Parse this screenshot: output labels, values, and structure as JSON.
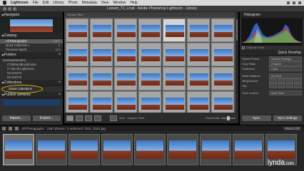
{
  "menubar": {
    "items": [
      "Lightroom",
      "File",
      "Edit",
      "Library",
      "Photo",
      "Metadata",
      "View",
      "Window",
      "Help"
    ]
  },
  "window": {
    "title": "Lesson_T1_Lrcat - Adobe Photoshop Lightroom - Library"
  },
  "left_panel": {
    "navigator_title": "Navigator",
    "catalog_title": "Catalog",
    "catalog_items": [
      {
        "label": "All Photographs",
        "count": "1267"
      },
      {
        "label": "Quick Collection +",
        "count": "0"
      },
      {
        "label": "Previous Import",
        "count": "113"
      }
    ],
    "folders_title": "Folders",
    "folders": [
      {
        "label": "DesktopMac(BH)",
        "count": ""
      },
      {
        "label": "CTM/Sandbox/photos",
        "count": ""
      },
      {
        "label": "IT ISB All Lightroom...",
        "count": ""
      },
      {
        "label": "03 SHOTS",
        "count": ""
      },
      {
        "label": "03 SHOTS",
        "count": ""
      }
    ],
    "collections_title": "Collections",
    "collection_item": "Smart Collections",
    "publish_title": "Publish Services",
    "import_label": "Import...",
    "export_label": "Export..."
  },
  "grid": {
    "header": "Library Filter :",
    "selected_index": 4
  },
  "toolbar": {
    "sort_label": "Sort:",
    "sort_value": "Capture Time",
    "thumbnails_label": "Thumbnails"
  },
  "right_panel": {
    "histogram_title": "Histogram",
    "original_photo_label": "Original Photo",
    "quick_develop_title": "Quick Develop",
    "rows": [
      {
        "label": "Saved Preset",
        "value": "Default Settings"
      },
      {
        "label": "Crop Ratio",
        "value": "Original"
      },
      {
        "label": "Treatment",
        "value": "Color"
      },
      {
        "label": "White Balance",
        "value": "As Shot"
      },
      {
        "label": "Temperature",
        "value": ""
      },
      {
        "label": "Tint",
        "value": ""
      },
      {
        "label": "Tone Control",
        "value": "Auto Tone"
      }
    ],
    "sync_label": "Sync",
    "sync_settings_label": "Sync Settings"
  },
  "filmstrip": {
    "source": "All Photographs",
    "count": "1267 photos / 1 selected / DSC_0181.jpg",
    "filter_label": "Filter:",
    "filter_value": "Filters Off"
  },
  "watermark": {
    "brand": "lynda",
    "suffix": ".com"
  }
}
